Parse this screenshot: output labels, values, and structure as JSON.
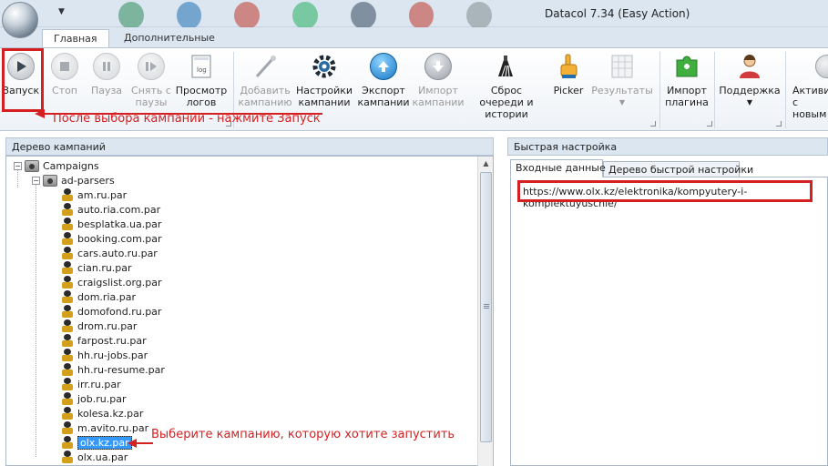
{
  "window": {
    "title": "Datacol 7.34 (Easy Action)"
  },
  "tabs": [
    {
      "label": "Главная",
      "active": true
    },
    {
      "label": "Дополнительные",
      "active": false
    }
  ],
  "ribbon": {
    "buttons": [
      {
        "label": "Запуск",
        "icon": "play-icon",
        "enabled": true
      },
      {
        "label": "Стоп",
        "icon": "stop-icon",
        "enabled": false
      },
      {
        "label": "Пауза",
        "icon": "pause-icon",
        "enabled": false
      },
      {
        "label": "Снять с паузы",
        "icon": "resume-icon",
        "enabled": false
      },
      {
        "label": "Просмотр логов",
        "icon": "log-file-icon",
        "enabled": true
      },
      {
        "label": "Добавить кампанию",
        "icon": "magic-wand-icon",
        "enabled": false
      },
      {
        "label": "Настройки кампании",
        "icon": "gear-icon",
        "enabled": true
      },
      {
        "label": "Экспорт кампании",
        "icon": "upload-arrow-icon",
        "enabled": true
      },
      {
        "label": "Импорт кампании",
        "icon": "download-arrow-icon",
        "enabled": false
      },
      {
        "label": "Сброс очереди и истории",
        "icon": "broom-icon",
        "enabled": true
      },
      {
        "label": "Picker",
        "icon": "pointing-hand-icon",
        "enabled": true
      },
      {
        "label": "Результаты",
        "icon": "table-icon",
        "enabled": false
      },
      {
        "label": "Импорт плагина",
        "icon": "puzzle-icon",
        "enabled": true
      },
      {
        "label": "Поддержка",
        "icon": "support-person-icon",
        "enabled": true
      },
      {
        "label": "Активи с новым",
        "icon": "activation-icon",
        "enabled": true
      }
    ]
  },
  "annotations": {
    "launch_hint": "После выбора кампании - нажмите Запуск",
    "select_hint": "Выберите кампанию, которую хотите запустить"
  },
  "left_panel": {
    "title": "Дерево кампаний",
    "root": "Campaigns",
    "folder": "ad-parsers",
    "items": [
      "am.ru.par",
      "auto.ria.com.par",
      "besplatka.ua.par",
      "booking.com.par",
      "cars.auto.ru.par",
      "cian.ru.par",
      "craigslist.org.par",
      "dom.ria.par",
      "domofond.ru.par",
      "drom.ru.par",
      "farpost.ru.par",
      "hh.ru-jobs.par",
      "hh.ru-resume.par",
      "irr.ru.par",
      "job.ru.par",
      "kolesa.kz.par",
      "m.avito.ru.par",
      "olx.kz.par",
      "olx.ua.par"
    ],
    "selected": "olx.kz.par"
  },
  "right_panel": {
    "title": "Быстрая настройка",
    "tabs": [
      {
        "label": "Входные данные",
        "active": true
      },
      {
        "label": "Дерево быстрой настройки",
        "active": false
      }
    ],
    "input_url": "https://www.olx.kz/elektronika/kompyutery-i-komplektuyuschie/"
  },
  "colors": {
    "annotation_red": "#d42020",
    "selection_blue": "#3399ff",
    "panel_header": "#dbe6f1"
  }
}
